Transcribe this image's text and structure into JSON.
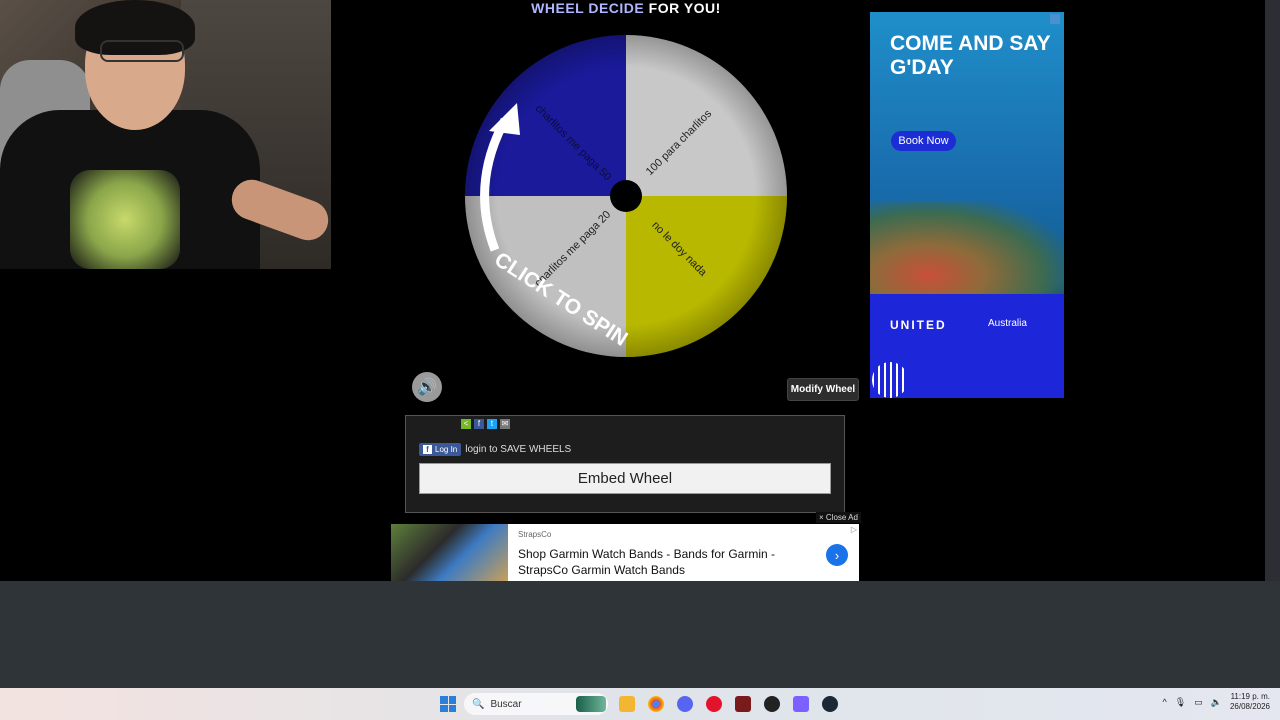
{
  "wheel": {
    "heading_accent": "WHEEL DECIDE",
    "heading_rest": "FOR YOU!",
    "segments": [
      {
        "label": "100 para charlitos",
        "color": "#c8c8c8"
      },
      {
        "label": "no le doy nada",
        "color": "#b8b800"
      },
      {
        "label": "charlitos me paga 20",
        "color": "#c0c0c0"
      },
      {
        "label": "charlitos me paga 50",
        "color": "#1a1a9a"
      }
    ],
    "spin_label": "CLICK TO SPIN"
  },
  "controls": {
    "modify_label": "Modify Wheel",
    "sound_icon": "speaker-icon"
  },
  "share": {
    "icons": [
      "share-icon",
      "facebook-icon",
      "twitter-icon",
      "email-icon"
    ],
    "fb_button": "Log In",
    "login_text": "login to SAVE WHEELS",
    "embed_label": "Embed Wheel"
  },
  "side_ad": {
    "title": "COME AND SAY G'DAY",
    "button": "Book Now",
    "brand": "UNITED",
    "brand_sub": "Australia"
  },
  "bottom_ad": {
    "close_label": "× Close Ad",
    "source": "StrapsCo",
    "text": "Shop Garmin Watch Bands - Bands for Garmin - StrapsCo Garmin Watch Bands"
  },
  "taskbar": {
    "search_placeholder": "Buscar",
    "time": "11:19 p. m.",
    "date": "26/08/2026"
  }
}
